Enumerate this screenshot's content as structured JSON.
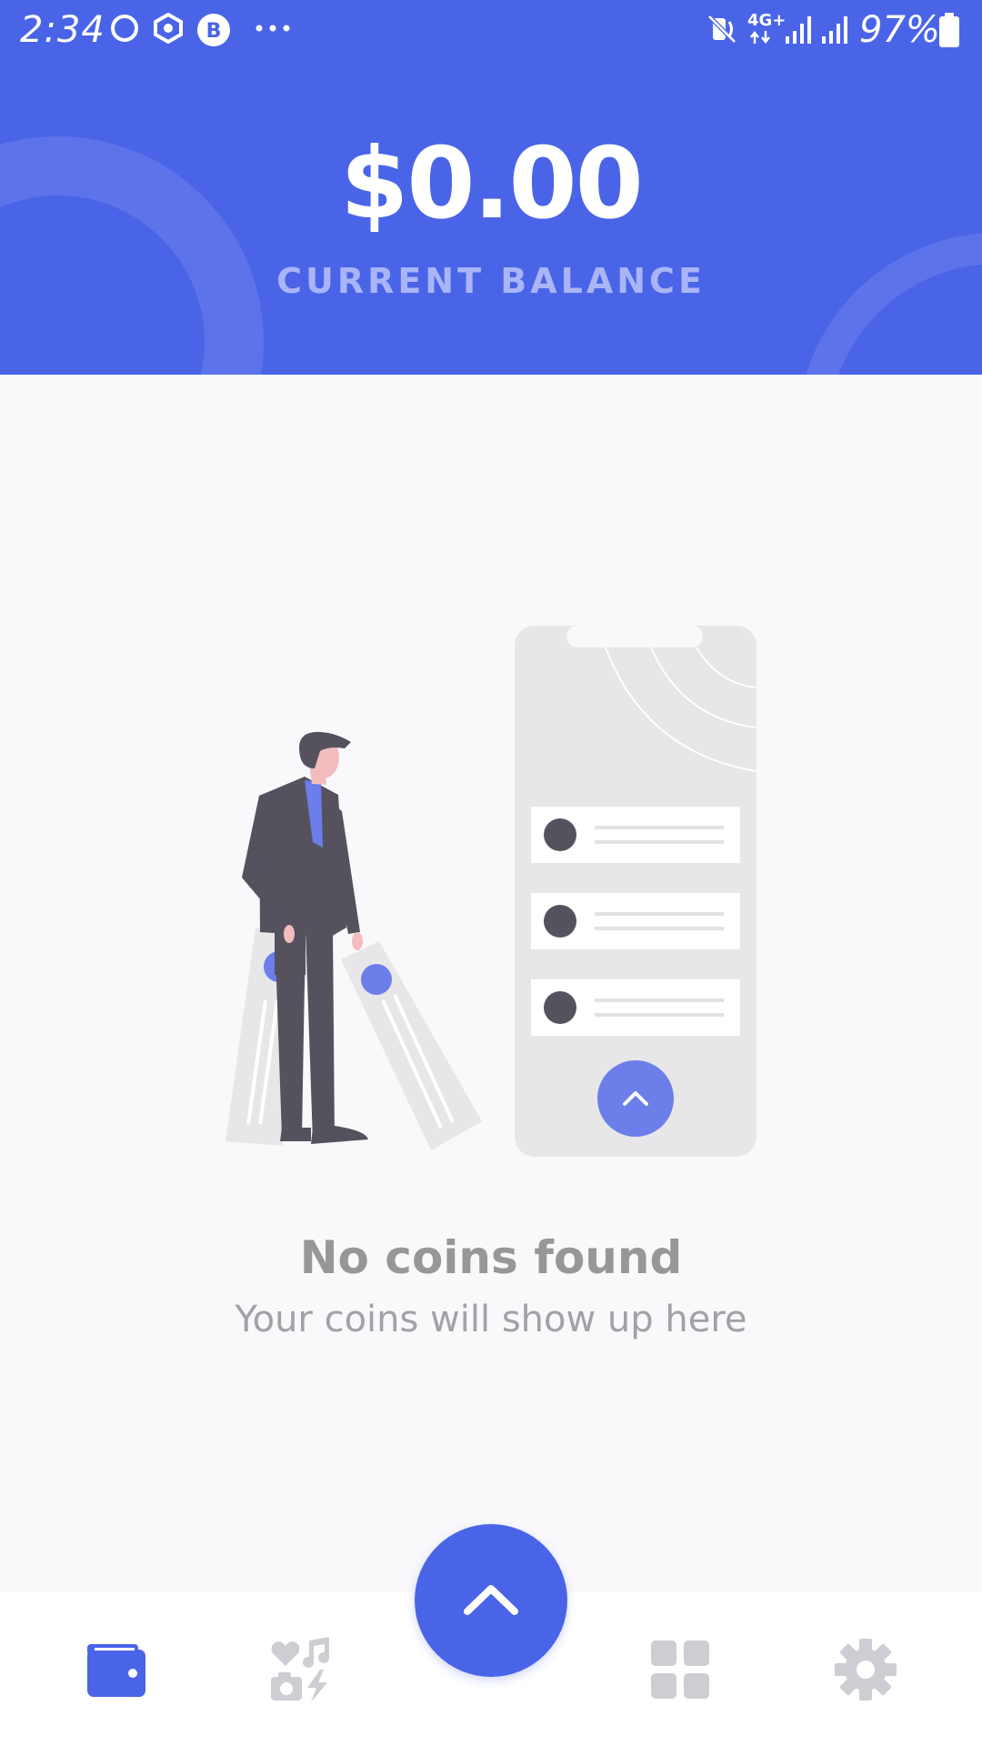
{
  "status_bar": {
    "time": "2:34",
    "network": "4G+",
    "battery": "97%",
    "icons": [
      "circle-icon",
      "hex-shield-icon",
      "b-badge-icon",
      "more-dots-icon",
      "mute-icon",
      "signal-icon",
      "signal-icon",
      "battery-icon"
    ]
  },
  "header": {
    "balance": "$0.00",
    "label": "CURRENT BALANCE",
    "background_color": "#4a64e8"
  },
  "empty_state": {
    "title": "No coins found",
    "subtitle": "Your coins will show up here"
  },
  "bottom_nav": {
    "items": [
      {
        "icon": "wallet-icon",
        "active": true
      },
      {
        "icon": "media-icon",
        "active": false
      },
      {
        "icon": "chevron-up-icon",
        "active": false
      },
      {
        "icon": "grid-icon",
        "active": false
      },
      {
        "icon": "gear-icon",
        "active": false
      }
    ],
    "accent_color": "#4a64e8",
    "inactive_color": "#cdced3"
  }
}
